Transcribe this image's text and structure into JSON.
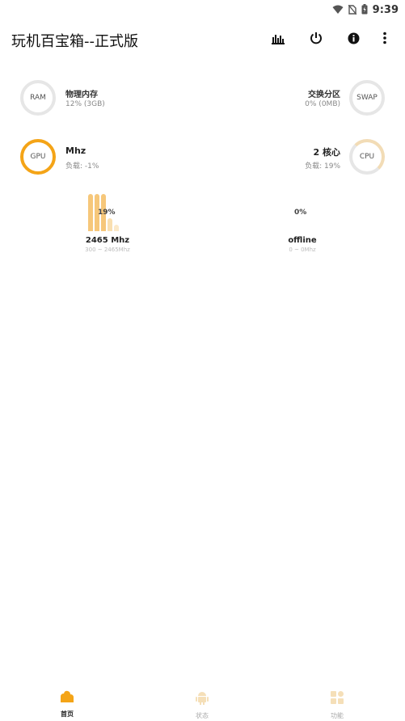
{
  "status_bar": {
    "time": "9:39",
    "icons": [
      "wifi-icon",
      "no-sim-icon",
      "battery-icon"
    ]
  },
  "app_bar": {
    "title": "玩机百宝箱--正式版",
    "actions": [
      "chart-icon",
      "power-icon",
      "info-icon",
      "more-vert-icon"
    ]
  },
  "ram": {
    "ring_label": "RAM",
    "title": "物理内存",
    "value": "12% (3GB)"
  },
  "swap": {
    "ring_label": "SWAP",
    "title": "交换分区",
    "value": "0% (0MB)"
  },
  "gpu": {
    "ring_label": "GPU",
    "title": "Mhz",
    "load": "负载: -1%"
  },
  "cpu": {
    "ring_label": "CPU",
    "title": "2 核心",
    "load": "负载: 19%"
  },
  "cores": [
    {
      "percent": "19%",
      "freq": "2465 Mhz",
      "range": "300 ~ 2465Mhz"
    },
    {
      "percent": "0%",
      "freq": "offline",
      "range": "0 ~ 0Mhz"
    }
  ],
  "bottom_nav": [
    {
      "label": "首页",
      "icon": "home-icon"
    },
    {
      "label": "状态",
      "icon": "android-icon"
    },
    {
      "label": "功能",
      "icon": "grid-icon"
    }
  ],
  "colors": {
    "accent": "#f4a417",
    "accent_light": "#f7cf8a",
    "inactive": "#f5dfb8"
  }
}
